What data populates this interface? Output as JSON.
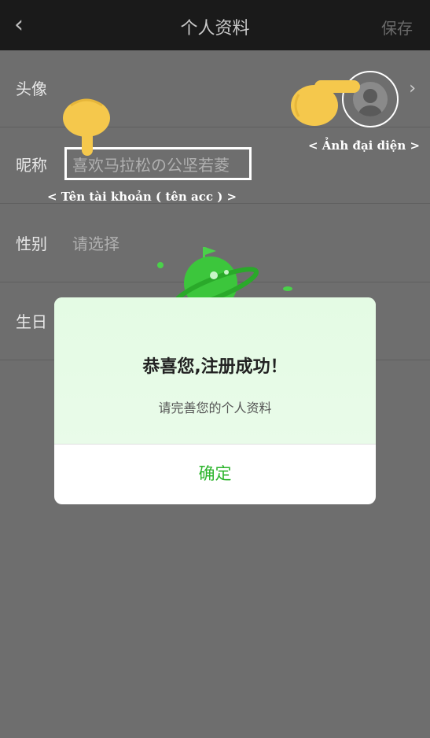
{
  "header": {
    "back_icon": "chevron-left-icon",
    "title": "个人资料",
    "save_label": "保存"
  },
  "rows": [
    {
      "label": "头像"
    },
    {
      "label": "昵称",
      "value": "喜欢马拉松の公坚若菱"
    },
    {
      "label": "性别",
      "value": "请选择"
    },
    {
      "label": "生日"
    }
  ],
  "annotations": {
    "avatar_note": "< Ảnh đại diện >",
    "account_note": "< Tên tài khoản ( tên acc ) >"
  },
  "dialog": {
    "headline": "恭喜您,注册成功！",
    "subtext": "请完善您的个人资料",
    "confirm_label": "确定"
  },
  "colors": {
    "accent": "#2db52d",
    "header_bg": "#1a1a1a",
    "overlay": "#6e6e6e"
  }
}
